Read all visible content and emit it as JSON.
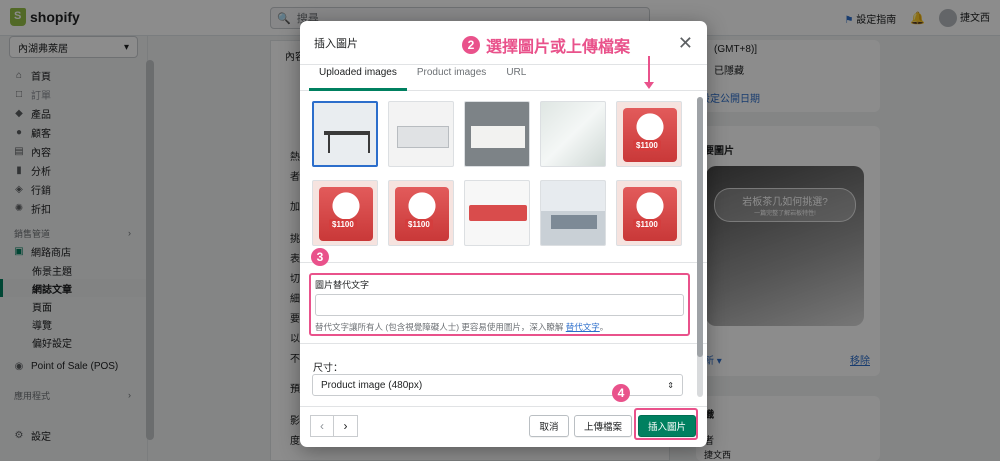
{
  "app": {
    "name": "shopify"
  },
  "header": {
    "search_placeholder": "搜尋",
    "setup_guide": "設定指南",
    "user_name": "捷文西"
  },
  "sidebar": {
    "store": "內湖弗萊居",
    "items": [
      {
        "label": "首頁",
        "icon": "home-icon"
      },
      {
        "label": "訂單",
        "icon": "orders-icon",
        "muted": true
      },
      {
        "label": "產品",
        "icon": "tag-icon"
      },
      {
        "label": "顧客",
        "icon": "customer-icon"
      },
      {
        "label": "內容",
        "icon": "content-icon"
      },
      {
        "label": "分析",
        "icon": "analytics-icon"
      },
      {
        "label": "行銷",
        "icon": "marketing-icon"
      },
      {
        "label": "折扣",
        "icon": "discount-icon"
      }
    ],
    "channels_label": "銷售管道",
    "online_store": "網路商店",
    "online_store_subs": [
      "佈景主題",
      "網誌文章",
      "頁面",
      "導覽",
      "偏好設定"
    ],
    "active_sub": "網誌文章",
    "pos": "Point of Sale (POS)",
    "apps_label": "應用程式",
    "settings": "設定"
  },
  "background": {
    "content_label": "內容",
    "left_letters": [
      "熱",
      "者",
      "加",
      "挑",
      "表",
      "切",
      "細",
      "要",
      "以",
      "不",
      "預",
      "影",
      "度"
    ],
    "right_lines": [
      "(GMT+8)]",
      "已隱藏",
      "設定公開日期"
    ],
    "feature_image_label": "要圖片",
    "promo_title": "岩板茶几如何挑選?",
    "promo_sub": "一篇完整了解岩板特性!",
    "change_link": "新",
    "remove_link": "移除",
    "org_label": "織",
    "org_sub": "者",
    "org_value": "捷文西"
  },
  "modal": {
    "title": "插入圖片",
    "tabs": [
      "Uploaded images",
      "Product images",
      "URL"
    ],
    "active_tab": "Uploaded images",
    "images": [
      {
        "name": "image-tea-table",
        "selected": true
      },
      {
        "name": "image-white-cabinet"
      },
      {
        "name": "image-wood-cabinet"
      },
      {
        "name": "image-marble"
      },
      {
        "name": "image-promo-1"
      },
      {
        "name": "image-promo-2"
      },
      {
        "name": "image-promo-3"
      },
      {
        "name": "image-banner"
      },
      {
        "name": "image-room"
      },
      {
        "name": "image-promo-4"
      }
    ],
    "alt_text_label": "圖片替代文字",
    "alt_text_value": "",
    "alt_help_prefix": "替代文字讓所有人 (包含視覺障礙人士) 更容易使用圖片，深入瞭解",
    "alt_help_link": "替代文字",
    "alt_help_suffix": "。",
    "size_label": "尺寸：",
    "size_value": "Product image (480px)",
    "cancel": "取消",
    "upload": "上傳檔案",
    "insert": "插入圖片"
  },
  "annotations": {
    "step2_num": "2",
    "step2_text": "選擇圖片或上傳檔案",
    "step3_num": "3",
    "step4_num": "4",
    "color": "#e9528b"
  },
  "colors": {
    "primary": "#008060",
    "link": "#2c6ecb"
  }
}
